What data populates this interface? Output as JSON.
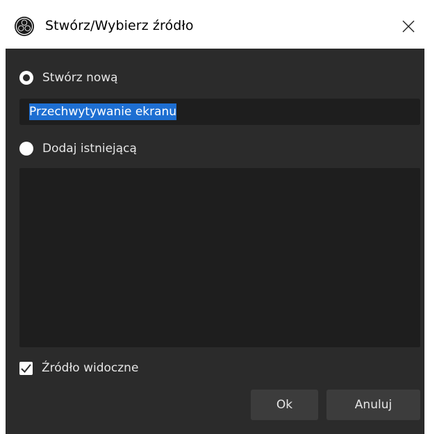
{
  "window": {
    "title": "Stwórz/Wybierz źródło",
    "app_icon": "obs-logo-icon",
    "close_icon": "close-icon"
  },
  "create_new": {
    "label": "Stwórz nową",
    "selected": true,
    "name_value": "Przechwytywanie ekranu",
    "name_selected": true
  },
  "add_existing": {
    "label": "Dodaj istniejącą",
    "selected": false,
    "items": []
  },
  "visible_checkbox": {
    "label": "Źródło widoczne",
    "checked": true
  },
  "buttons": {
    "ok_label": "Ok",
    "cancel_label": "Anuluj"
  },
  "colors": {
    "background": "#2b2b2b",
    "input_background": "#1e1e1e",
    "selection": "#1e6fd2",
    "button": "#3c3c3c",
    "text": "#e6e6e6"
  }
}
